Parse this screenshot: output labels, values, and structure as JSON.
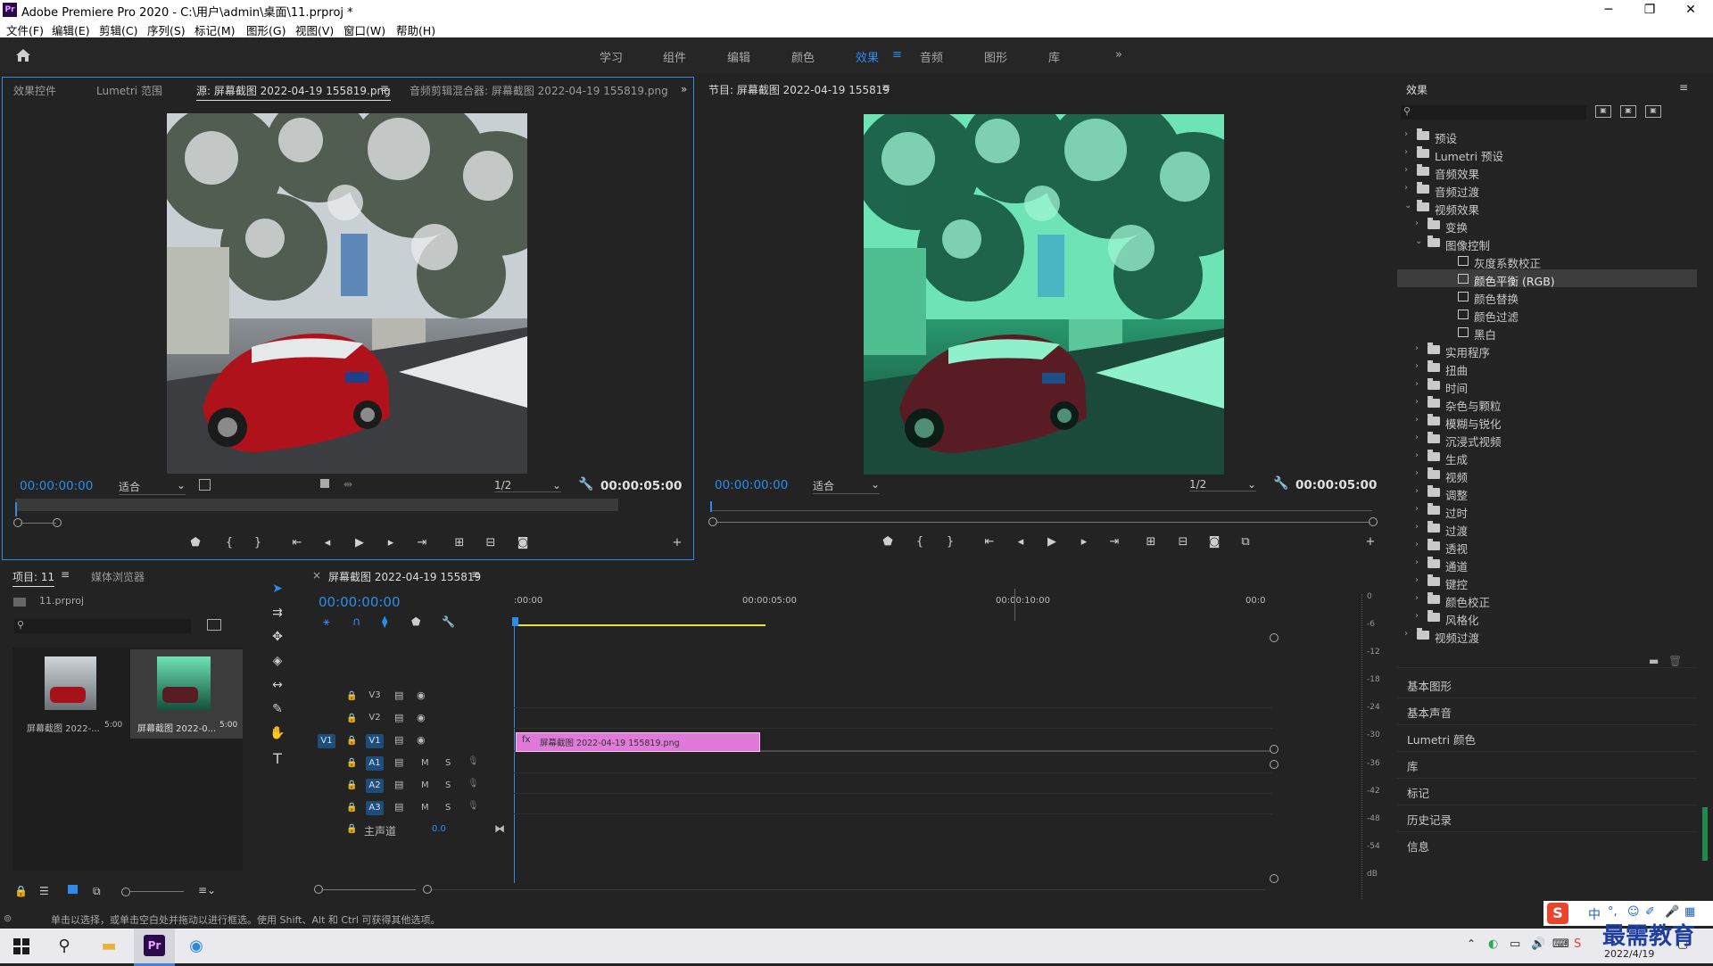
{
  "window": {
    "title": "Adobe Premiere Pro 2020 - C:\\用户\\admin\\桌面\\11.prproj *",
    "logo": "Pr",
    "controls": [
      "─",
      "❐",
      "✕"
    ]
  },
  "menu": [
    "文件(F)",
    "编辑(E)",
    "剪辑(C)",
    "序列(S)",
    "标记(M)",
    "图形(G)",
    "视图(V)",
    "窗口(W)",
    "帮助(H)"
  ],
  "workspaces": {
    "items": [
      "学习",
      "组件",
      "编辑",
      "颜色",
      "效果",
      "音频",
      "图形",
      "库"
    ],
    "active": "效果",
    "more": "»"
  },
  "source_panel": {
    "tabs": [
      "效果控件",
      "Lumetri 范围",
      "源: 屏幕截图 2022-04-19 155819.png",
      "音频剪辑混合器: 屏幕截图 2022-04-19 155819.png"
    ],
    "timecode_in": "00:00:00:00",
    "fit": "适合",
    "resolution": "1/2",
    "duration": "00:00:05:00"
  },
  "program_panel": {
    "tab": "节目: 屏幕截图 2022-04-19 155819",
    "timecode_in": "00:00:00:00",
    "fit": "适合",
    "resolution": "1/2",
    "duration": "00:00:05:00"
  },
  "effects_panel": {
    "title": "效果",
    "tree": [
      {
        "label": "预设",
        "level": 0,
        "type": "folder",
        "arrow": "›"
      },
      {
        "label": "Lumetri 预设",
        "level": 0,
        "type": "folder",
        "arrow": "›"
      },
      {
        "label": "音频效果",
        "level": 0,
        "type": "folder",
        "arrow": "›"
      },
      {
        "label": "音频过渡",
        "level": 0,
        "type": "folder",
        "arrow": "›"
      },
      {
        "label": "视频效果",
        "level": 0,
        "type": "folder",
        "arrow": "⌄"
      },
      {
        "label": "变换",
        "level": 1,
        "type": "folder",
        "arrow": "›"
      },
      {
        "label": "图像控制",
        "level": 1,
        "type": "folder",
        "arrow": "⌄"
      },
      {
        "label": "灰度系数校正",
        "level": 2,
        "type": "fx",
        "arrow": ""
      },
      {
        "label": "颜色平衡 (RGB)",
        "level": 2,
        "type": "fx",
        "arrow": "",
        "selected": true
      },
      {
        "label": "颜色替换",
        "level": 2,
        "type": "fx",
        "arrow": ""
      },
      {
        "label": "颜色过滤",
        "level": 2,
        "type": "fx",
        "arrow": ""
      },
      {
        "label": "黑白",
        "level": 2,
        "type": "fx",
        "arrow": ""
      },
      {
        "label": "实用程序",
        "level": 1,
        "type": "folder",
        "arrow": "›"
      },
      {
        "label": "扭曲",
        "level": 1,
        "type": "folder",
        "arrow": "›"
      },
      {
        "label": "时间",
        "level": 1,
        "type": "folder",
        "arrow": "›"
      },
      {
        "label": "杂色与颗粒",
        "level": 1,
        "type": "folder",
        "arrow": "›"
      },
      {
        "label": "模糊与锐化",
        "level": 1,
        "type": "folder",
        "arrow": "›"
      },
      {
        "label": "沉浸式视频",
        "level": 1,
        "type": "folder",
        "arrow": "›"
      },
      {
        "label": "生成",
        "level": 1,
        "type": "folder",
        "arrow": "›"
      },
      {
        "label": "视频",
        "level": 1,
        "type": "folder",
        "arrow": "›"
      },
      {
        "label": "调整",
        "level": 1,
        "type": "folder",
        "arrow": "›"
      },
      {
        "label": "过时",
        "level": 1,
        "type": "folder",
        "arrow": "›"
      },
      {
        "label": "过渡",
        "level": 1,
        "type": "folder",
        "arrow": "›"
      },
      {
        "label": "透视",
        "level": 1,
        "type": "folder",
        "arrow": "›"
      },
      {
        "label": "通道",
        "level": 1,
        "type": "folder",
        "arrow": "›"
      },
      {
        "label": "键控",
        "level": 1,
        "type": "folder",
        "arrow": "›"
      },
      {
        "label": "颜色校正",
        "level": 1,
        "type": "folder",
        "arrow": "›"
      },
      {
        "label": "风格化",
        "level": 1,
        "type": "folder",
        "arrow": "›"
      },
      {
        "label": "视频过渡",
        "level": 0,
        "type": "folder",
        "arrow": "›"
      }
    ],
    "side_panels": [
      "基本图形",
      "基本声音",
      "Lumetri 颜色",
      "库",
      "标记",
      "历史记录",
      "信息"
    ]
  },
  "project_panel": {
    "tabs": [
      "项目: 11",
      "媒体浏览器"
    ],
    "file": "11.prproj",
    "items": [
      {
        "name": "屏幕截图 2022-...",
        "duration": "5:00"
      },
      {
        "name": "屏幕截图 2022-0...",
        "duration": "5:00"
      }
    ]
  },
  "timeline": {
    "tab": "屏幕截图 2022-04-19 155819",
    "timecode": "00:00:00:00",
    "ruler": [
      ":00:00",
      "00:00:05:00",
      "00:00:10:00",
      "00:0"
    ],
    "video_tracks": [
      "V3",
      "V2",
      "V1"
    ],
    "audio_tracks": [
      "A1",
      "A2",
      "A3"
    ],
    "source_patch": "V1",
    "master": "主声道",
    "master_value": "0.0",
    "clip": "屏幕截图 2022-04-19 155819.png",
    "mute": "M",
    "solo": "S",
    "meter_labels": [
      "0",
      "-6",
      "-12",
      "-18",
      "-24",
      "-30",
      "-36",
      "-42",
      "-48",
      "-54",
      "dB"
    ]
  },
  "status": "单击以选择，或单击空白处并拖动以进行框选。使用 Shift、Alt 和 Ctrl 可获得其他选项。",
  "ime": [
    "中",
    "°,",
    "☺",
    "✐",
    "🎤",
    "▦"
  ],
  "watermark": "最需教育",
  "taskbar": {
    "date": "2022/4/19",
    "app_label": "Pr"
  },
  "colors": {
    "accent": "#2d8ceb",
    "clip": "#e07ad8",
    "panel_border": "#2d8ceb"
  }
}
